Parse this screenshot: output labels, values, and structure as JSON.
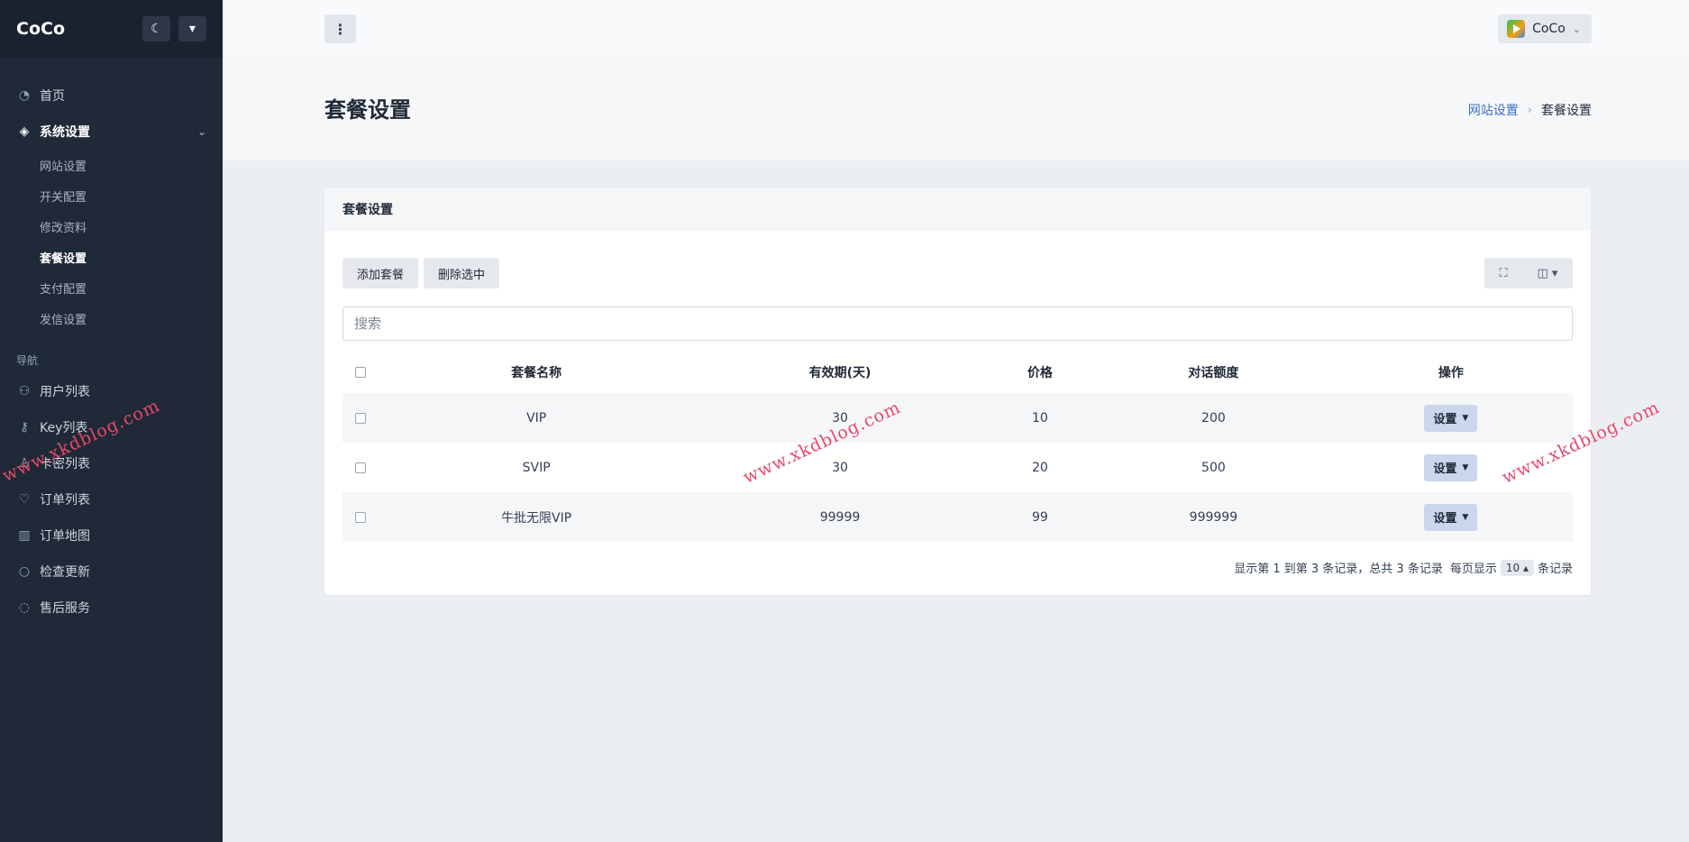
{
  "sidebar": {
    "brand": "CoCo",
    "items": [
      {
        "label": "首页",
        "icon": "dashboard-icon"
      },
      {
        "label": "系统设置",
        "icon": "layers-icon"
      }
    ],
    "sub_items": [
      "网站设置",
      "开关配置",
      "修改资料",
      "套餐设置",
      "支付配置",
      "发信设置"
    ],
    "section_heading": "导航",
    "nav_items": [
      {
        "label": "用户列表",
        "icon": "users-icon"
      },
      {
        "label": "Key列表",
        "icon": "key-icon"
      },
      {
        "label": "卡密列表",
        "icon": "user-icon"
      },
      {
        "label": "订单列表",
        "icon": "heart-icon"
      },
      {
        "label": "订单地图",
        "icon": "map-icon"
      },
      {
        "label": "检查更新",
        "icon": "refresh-icon"
      },
      {
        "label": "售后服务",
        "icon": "chat-icon"
      }
    ]
  },
  "header": {
    "username": "CoCo"
  },
  "page": {
    "title": "套餐设置",
    "breadcrumb_parent": "网站设置",
    "breadcrumb_current": "套餐设置"
  },
  "card": {
    "title": "套餐设置",
    "add_label": "添加套餐",
    "delete_label": "删除选中",
    "search_placeholder": "搜索"
  },
  "table": {
    "headers": [
      "套餐名称",
      "有效期(天)",
      "价格",
      "对话额度",
      "操作"
    ],
    "rows": [
      {
        "name": "VIP",
        "days": "30",
        "price": "10",
        "quota": "200",
        "action": "设置"
      },
      {
        "name": "SVIP",
        "days": "30",
        "price": "20",
        "quota": "500",
        "action": "设置"
      },
      {
        "name": "牛批无限VIP",
        "days": "99999",
        "price": "99",
        "quota": "999999",
        "action": "设置"
      }
    ]
  },
  "pagination": {
    "summary": "显示第 1 到第 3 条记录，总共 3 条记录",
    "per_page_prefix": "每页显示",
    "per_page_value": "10",
    "per_page_suffix": "条记录"
  },
  "watermark": "www.xkdblog.com"
}
